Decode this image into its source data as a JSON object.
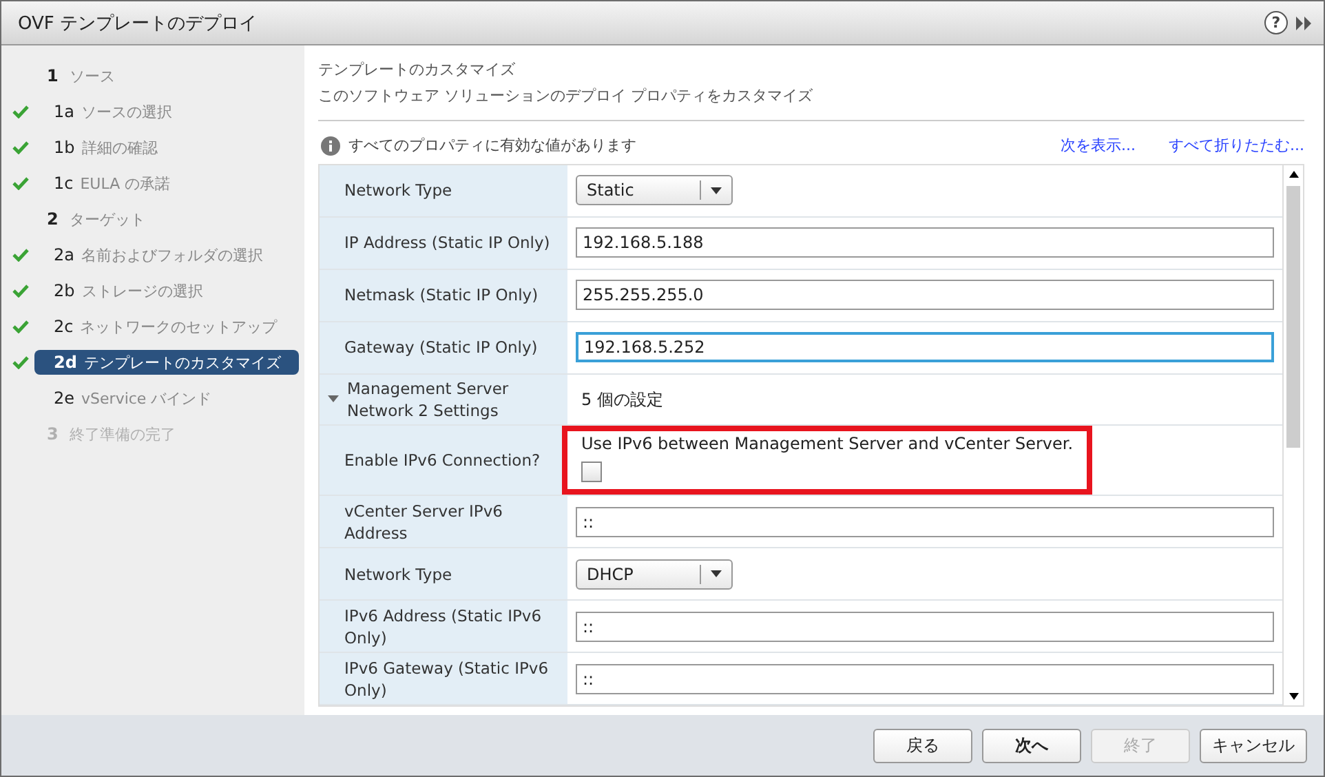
{
  "window": {
    "title": "OVF テンプレートのデプロイ",
    "help": "?"
  },
  "steps": [
    {
      "number": "1",
      "label": "ソース",
      "done": false,
      "selected": false,
      "disabled": false,
      "children": [
        {
          "number": "1a",
          "label": "ソースの選択",
          "done": true,
          "selected": false,
          "disabled": false
        },
        {
          "number": "1b",
          "label": "詳細の確認",
          "done": true,
          "selected": false,
          "disabled": false
        },
        {
          "number": "1c",
          "label": "EULA の承諾",
          "done": true,
          "selected": false,
          "disabled": false
        }
      ]
    },
    {
      "number": "2",
      "label": "ターゲット",
      "done": false,
      "selected": false,
      "disabled": false,
      "children": [
        {
          "number": "2a",
          "label": "名前およびフォルダの選択",
          "done": true,
          "selected": false,
          "disabled": false
        },
        {
          "number": "2b",
          "label": "ストレージの選択",
          "done": true,
          "selected": false,
          "disabled": false
        },
        {
          "number": "2c",
          "label": "ネットワークのセットアップ",
          "done": true,
          "selected": false,
          "disabled": false
        },
        {
          "number": "2d",
          "label": "テンプレートのカスタマイズ",
          "done": true,
          "selected": true,
          "disabled": false
        },
        {
          "number": "2e",
          "label": "vService バインド",
          "done": false,
          "selected": false,
          "disabled": false
        }
      ]
    },
    {
      "number": "3",
      "label": "終了準備の完了",
      "done": false,
      "selected": false,
      "disabled": true
    }
  ],
  "header": {
    "title": "テンプレートのカスタマイズ",
    "subtitle": "このソフトウェア ソリューションのデプロイ プロパティをカスタマイズ"
  },
  "info": {
    "message": "すべてのプロパティに有効な値があります",
    "links": [
      "次を表示...",
      "すべて折りたたむ..."
    ]
  },
  "properties": [
    {
      "kind": "select",
      "label": "Network Type",
      "value": "Static"
    },
    {
      "kind": "text",
      "label": "IP Address (Static IP Only)",
      "value": "192.168.5.188",
      "focused": false
    },
    {
      "kind": "text",
      "label": "Netmask (Static IP Only)",
      "value": "255.255.255.0",
      "focused": false
    },
    {
      "kind": "text",
      "label": "Gateway (Static IP Only)",
      "value": "192.168.5.252",
      "focused": true
    },
    {
      "kind": "section",
      "label": "Management Server Network 2 Settings",
      "value": "5 個の設定",
      "expanded": true
    },
    {
      "kind": "checkbox",
      "label": "Enable IPv6 Connection?",
      "description": "Use IPv6 between Management Server and vCenter Server.",
      "checked": false,
      "highlighted": true
    },
    {
      "kind": "text",
      "label": "vCenter Server IPv6 Address",
      "value": "::",
      "focused": false
    },
    {
      "kind": "select",
      "label": "Network Type",
      "value": "DHCP"
    },
    {
      "kind": "text",
      "label": "IPv6 Address (Static IPv6 Only)",
      "value": "::",
      "focused": false
    },
    {
      "kind": "text",
      "label": "IPv6 Gateway (Static IPv6 Only)",
      "value": "::",
      "focused": false
    }
  ],
  "buttons": [
    {
      "label": "戻る",
      "disabled": false,
      "primary": false
    },
    {
      "label": "次へ",
      "disabled": false,
      "primary": true
    },
    {
      "label": "終了",
      "disabled": true,
      "primary": false
    },
    {
      "label": "キャンセル",
      "disabled": false,
      "primary": false
    }
  ]
}
